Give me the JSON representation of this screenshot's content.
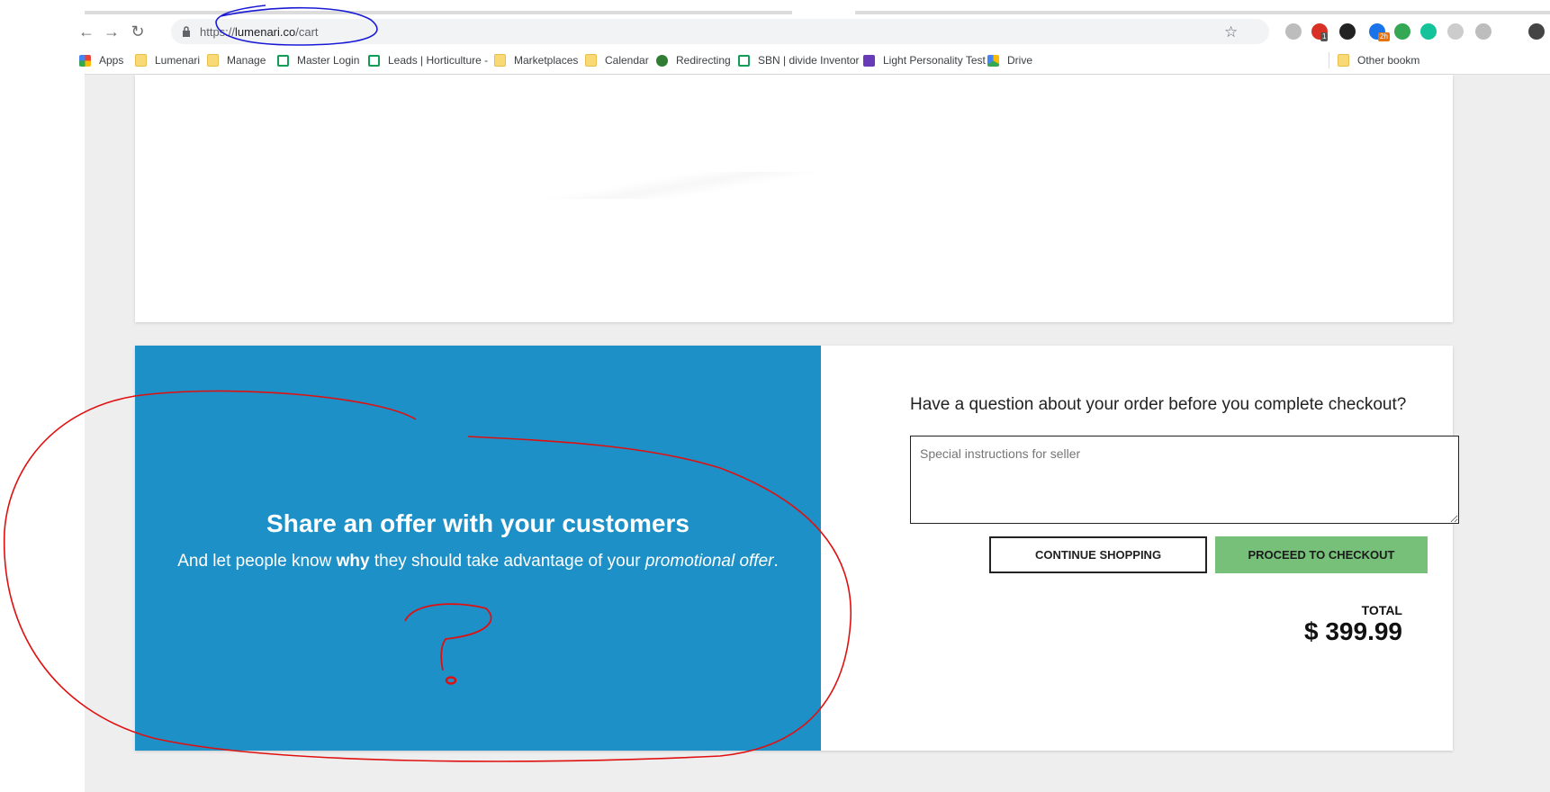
{
  "browser": {
    "url_prefix": "https://",
    "url_host": "lumenari.co",
    "url_path": "/cart",
    "extensions": [
      {
        "name": "cloud-icon",
        "color": "#bdbdbd"
      },
      {
        "name": "adblock-icon",
        "color": "#d93025",
        "badge": "1"
      },
      {
        "name": "arrow-icon",
        "color": "#222222"
      },
      {
        "name": "calendar-icon",
        "color": "#1a73e8",
        "badge": "2h"
      },
      {
        "name": "drive-icon",
        "color": "#34a853"
      },
      {
        "name": "grammarly-icon",
        "color": "#15c39a"
      },
      {
        "name": "extension-icon",
        "color": "#cccccc"
      },
      {
        "name": "upwork-icon",
        "color": "#bdbdbd"
      }
    ],
    "bookmarks": [
      {
        "label": "Apps",
        "icon": "apps-grid-icon"
      },
      {
        "label": "Lumenari",
        "icon": "folder-icon"
      },
      {
        "label": "Manage",
        "icon": "folder-icon"
      },
      {
        "label": "Master Login",
        "icon": "sheets-icon"
      },
      {
        "label": "Leads | Horticulture -",
        "icon": "sheets-icon"
      },
      {
        "label": "Marketplaces",
        "icon": "folder-icon"
      },
      {
        "label": "Calendar",
        "icon": "folder-icon"
      },
      {
        "label": "Redirecting",
        "icon": "redirect-icon"
      },
      {
        "label": "SBN | divide Inventor",
        "icon": "sheets-icon"
      },
      {
        "label": "Light Personality Test",
        "icon": "forms-icon"
      },
      {
        "label": "Drive",
        "icon": "drive-icon"
      },
      {
        "label": "Other bookm",
        "icon": "folder-icon"
      }
    ]
  },
  "promo": {
    "title": "Share an offer with your customers",
    "text_before": "And let people know ",
    "text_bold": "why",
    "text_middle": " they should take advantage of your ",
    "text_italic": "promotional offer",
    "text_after": "."
  },
  "checkout": {
    "question": "Have a question about your order before you complete checkout?",
    "notes_placeholder": "Special instructions for seller",
    "continue_label": "CONTINUE SHOPPING",
    "checkout_label": "PROCEED TO CHECKOUT",
    "total_label": "TOTAL",
    "total_value": "$ 399.99"
  },
  "colors": {
    "promo_bg": "#1c90c7",
    "checkout_button": "#76c07a",
    "annotation_blue": "#1a1ad6",
    "annotation_red": "#e01010"
  }
}
